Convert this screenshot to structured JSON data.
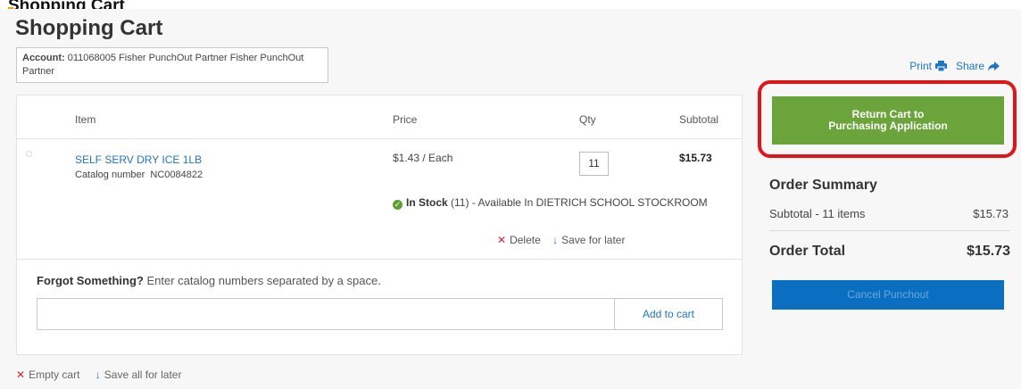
{
  "page": {
    "top_peek": "Shopping Cart",
    "title": "Shopping Cart"
  },
  "account": {
    "label": "Account:",
    "value": "011068005 Fisher PunchOut Partner Fisher PunchOut Partner"
  },
  "toplinks": {
    "print": "Print",
    "share": "Share",
    "print_icon": "printer-icon",
    "share_icon": "share-arrow-icon"
  },
  "table": {
    "headers": {
      "item": "Item",
      "price": "Price",
      "qty": "Qty",
      "subtotal": "Subtotal"
    },
    "row": {
      "item_name": "SELF SERV DRY ICE 1LB",
      "catalog_label": "Catalog number",
      "catalog_number": "NC0084822",
      "price": "$1.43 / Each",
      "qty": "11",
      "subtotal": "$15.73",
      "stock_label": "In Stock",
      "stock_detail": "(11) - Available In  DIETRICH SCHOOL STOCKROOM",
      "delete_label": "Delete",
      "save_later_label": "Save for later"
    }
  },
  "forgot": {
    "bold": "Forgot Something?",
    "text": "Enter catalog numbers separated by a space.",
    "input_value": "",
    "add_button": "Add to cart"
  },
  "bottom": {
    "empty_cart": "Empty cart",
    "save_all": "Save all for later"
  },
  "sidebar": {
    "return_button_line1": "Return Cart to",
    "return_button_line2": "Purchasing Application",
    "summary_title": "Order Summary",
    "subtotal_label": "Subtotal - 11 items",
    "subtotal_value": "$15.73",
    "total_label": "Order Total",
    "total_value": "$15.73",
    "cancel_button": "Cancel Punchout"
  },
  "colors": {
    "link_blue": "#1f74c4",
    "return_green": "#6aa43a",
    "cancel_blue": "#0b6fc1",
    "highlight_red": "#e0151a",
    "delete_red": "#d9262c",
    "stock_green": "#5aa02c"
  }
}
